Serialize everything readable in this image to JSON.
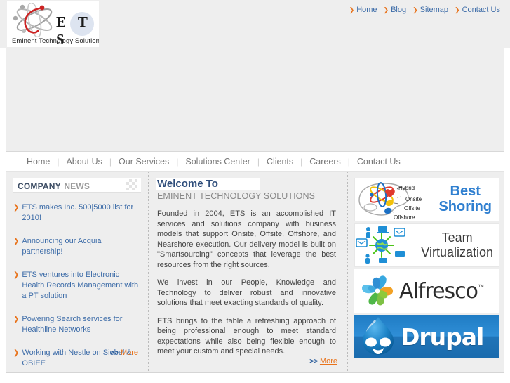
{
  "site": {
    "logo_letters": "E T S",
    "logo_tagline": "Eminent Technology Solutions"
  },
  "toplinks": [
    {
      "label": "Home",
      "icon": "chevron-right-icon"
    },
    {
      "label": "Blog",
      "icon": "chevron-right-icon"
    },
    {
      "label": "Sitemap",
      "icon": "chevron-right-icon"
    },
    {
      "label": "Contact Us",
      "icon": "chevron-right-icon"
    }
  ],
  "mainnav": [
    {
      "label": "Home"
    },
    {
      "label": "About Us"
    },
    {
      "label": "Our Services"
    },
    {
      "label": "Solutions Center"
    },
    {
      "label": "Clients"
    },
    {
      "label": "Careers"
    },
    {
      "label": "Contact Us"
    }
  ],
  "news": {
    "title_strong": "COMPANY",
    "title_light": "NEWS",
    "items": [
      {
        "text": "ETS makes Inc. 500|5000 list for 2010!"
      },
      {
        "text": "Announcing our Acquia partnership!"
      },
      {
        "text": "ETS ventures into Electronic Health Records Management with a PT solution"
      },
      {
        "text": "Powering Search services for Healthline Networks"
      },
      {
        "text": "Working with Nestle on Siebel & OBIEE"
      }
    ],
    "more_chev": ">>",
    "more_label": "More"
  },
  "welcome": {
    "title": "Welcome To",
    "subtitle": "EMINENT TECHNOLOGY SOLUTIONS",
    "paragraphs": [
      "Founded in 2004, ETS is an accomplished IT services and solutions company with business models that support Onsite, Offsite, Offshore, and Nearshore execution. Our delivery model is built on \"Smartsourcing\" concepts that leverage the best resources from the right sources.",
      "We invest in our People, Knowledge and Technology to deliver robust and innovative solutions that meet exacting standards of quality.",
      "ETS brings to the table a refreshing approach of being professional enough to meet standard expectations while also being flexible enough to meet your custom and special needs."
    ],
    "more_chev": ">>",
    "more_label": "More"
  },
  "ads": {
    "best_shoring": {
      "line1": "Best",
      "line2": "Shoring",
      "labels": [
        "Hybrid",
        "Onsite",
        "Offsite",
        "Offshore"
      ]
    },
    "team_virtualization": {
      "line1": "Team",
      "line2": "Virtualization"
    },
    "alfresco": {
      "label": "Alfresco",
      "tm": "™"
    },
    "drupal": {
      "label": "Drupal"
    }
  },
  "colors": {
    "accent_orange": "#e8731c",
    "link_blue": "#3d6ca8",
    "heading_blue": "#2e4d7b",
    "page_bg": "#eeeeee",
    "drupal_blue": "#2f8ed6"
  }
}
